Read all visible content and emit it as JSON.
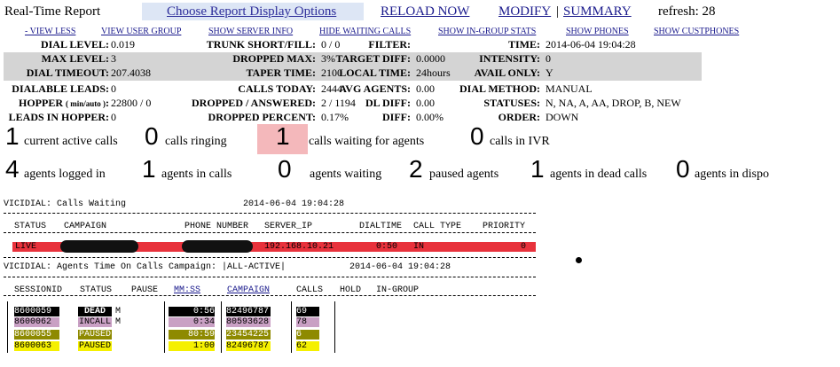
{
  "header": {
    "title": "Real-Time Report",
    "display_options": "Choose Report Display Options",
    "reload": "RELOAD NOW",
    "modify": "MODIFY",
    "separator": "|",
    "summary": "SUMMARY",
    "refresh_label": "refresh: 28"
  },
  "nav": [
    "- VIEW LESS",
    "VIEW USER GROUP",
    "SHOW SERVER INFO",
    "HIDE WAITING CALLS",
    "SHOW IN-GROUP STATS",
    "SHOW PHONES",
    "SHOW CUSTPHONES"
  ],
  "stats": {
    "dial_level": {
      "label": "DIAL LEVEL:",
      "value": "0.019"
    },
    "trunk": {
      "label": "TRUNK SHORT/FILL:",
      "value": "0 / 0"
    },
    "filter": {
      "label": "FILTER:",
      "value": ""
    },
    "time": {
      "label": "TIME:",
      "value": "2014-06-04 19:04:28"
    },
    "max_level": {
      "label": "MAX LEVEL:",
      "value": "3"
    },
    "dropped_max": {
      "label": "DROPPED MAX:",
      "value": "3%"
    },
    "target_diff": {
      "label": "TARGET DIFF:",
      "value": "0.0000"
    },
    "intensity": {
      "label": "INTENSITY:",
      "value": "0"
    },
    "dial_timeout": {
      "label": "DIAL TIMEOUT:",
      "value": "207.4038"
    },
    "taper_time": {
      "label": "TAPER TIME:",
      "value": "2100"
    },
    "local_time": {
      "label": "LOCAL TIME:",
      "value": "24hours"
    },
    "avail_only": {
      "label": "AVAIL ONLY:",
      "value": "Y"
    },
    "dialable": {
      "label": "DIALABLE LEADS:",
      "value": "0"
    },
    "calls_today": {
      "label": "CALLS TODAY:",
      "value": "2444"
    },
    "avg_agents": {
      "label": "AVG AGENTS:",
      "value": "0.00"
    },
    "dial_method": {
      "label": "DIAL METHOD:",
      "value": "MANUAL"
    },
    "hopper_label": "HOPPER",
    "hopper_sub": "( min/auto )",
    "hopper_colon": ":",
    "hopper_value": "22800 / 0",
    "dropped_answered": {
      "label": "DROPPED / ANSWERED:",
      "value": "2 / 1194"
    },
    "dl_diff": {
      "label": "DL DIFF:",
      "value": "0.00"
    },
    "statuses": {
      "label": "STATUSES:",
      "value": "N, NA, A, AA, DROP, B, NEW"
    },
    "leads_hopper": {
      "label": "LEADS IN HOPPER:",
      "value": "0"
    },
    "dropped_percent": {
      "label": "DROPPED PERCENT:",
      "value": "0.17%"
    },
    "diff": {
      "label": "DIFF:",
      "value": "0.00%"
    },
    "order": {
      "label": "ORDER:",
      "value": "DOWN"
    }
  },
  "summary_row1": [
    {
      "count": "1",
      "text": "current active calls"
    },
    {
      "count": "0",
      "text": "calls ringing"
    },
    {
      "count": "1",
      "text": "calls waiting for agents"
    },
    {
      "count": "0",
      "text": "calls in IVR"
    }
  ],
  "summary_row2": [
    {
      "count": "4",
      "text": "agents logged in"
    },
    {
      "count": "1",
      "text": "agents in calls"
    },
    {
      "count": "0",
      "text": "agents waiting"
    },
    {
      "count": "2",
      "text": "paused agents"
    },
    {
      "count": "1",
      "text": "agents in dead calls"
    },
    {
      "count": "0",
      "text": "agents in dispo"
    }
  ],
  "waiting_table": {
    "title": "VICIDIAL: Calls Waiting",
    "timestamp": "2014-06-04 19:04:28",
    "headers": [
      "STATUS",
      "CAMPAIGN",
      "PHONE NUMBER",
      "SERVER_IP",
      "DIALTIME",
      "CALL TYPE",
      "PRIORITY"
    ],
    "row": {
      "status": "LIVE",
      "campaign": "",
      "phone": "",
      "server_ip": "192.168.10.21",
      "dialtime": "0:50",
      "call_type": "IN",
      "priority": "0"
    }
  },
  "agents_table": {
    "title": "VICIDIAL: Agents Time On Calls Campaign: |ALL-ACTIVE|",
    "timestamp": "2014-06-04 19:04:28",
    "headers": [
      "SESSIONID",
      "STATUS",
      "PAUSE",
      "MM:SS",
      "CAMPAIGN",
      "CALLS",
      "HOLD",
      "IN-GROUP"
    ],
    "rows": [
      {
        "session": "8600059",
        "status": "DEAD",
        "flag": "M",
        "mmss": "0:56",
        "campaign": "82496787",
        "calls": "69"
      },
      {
        "session": "8600062",
        "status": "INCALL",
        "flag": "M",
        "mmss": "0:34",
        "campaign": "80593628",
        "calls": "78"
      },
      {
        "session": "8600055",
        "status": "PAUSED",
        "flag": "",
        "mmss": "80:59",
        "campaign": "23454225",
        "calls": "6"
      },
      {
        "session": "8600063",
        "status": "PAUSED",
        "flag": "",
        "mmss": "1:00",
        "campaign": "82496787",
        "calls": "62"
      }
    ]
  },
  "colors": {
    "live": "#e8323c",
    "dead": "#000000",
    "incall": "#c9a0c4",
    "paused_dark": "#8e8a00",
    "paused_light": "#f5f000",
    "highlight_waiting": "#f4b8bb",
    "gray_band": "#d4d4d4",
    "link": "#1a1a8c"
  }
}
